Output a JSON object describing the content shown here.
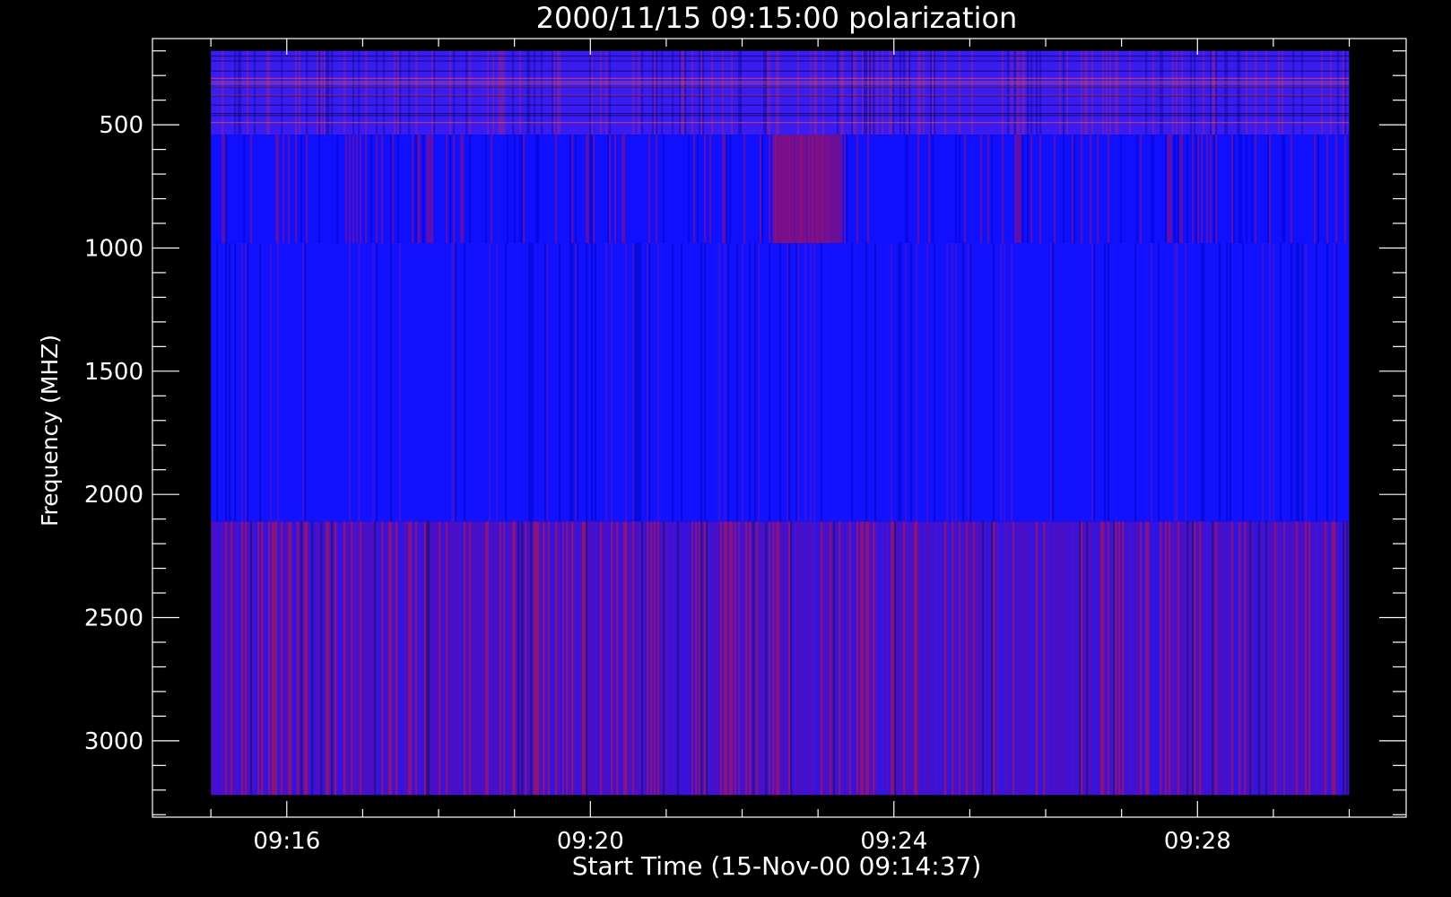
{
  "chart_data": {
    "type": "heatmap",
    "title": "2000/11/15 09:15:00 polarization",
    "xlabel": "Start Time (15-Nov-00 09:14:37)",
    "ylabel": "Frequency (MHZ)",
    "x_tick_labels": [
      "09:16",
      "09:20",
      "09:24",
      "09:28"
    ],
    "x_ticks_minutes": [
      16,
      20,
      24,
      28
    ],
    "x_range_minutes": [
      14.23,
      30.75
    ],
    "y_tick_labels": [
      "500",
      "1000",
      "1500",
      "2000",
      "2500",
      "3000"
    ],
    "y_ticks": [
      500,
      1000,
      1500,
      2000,
      2500,
      3000
    ],
    "y_range": [
      3310,
      150
    ],
    "y_reversed": true,
    "data_time_range_minutes": [
      15.0,
      30.0
    ],
    "data_freq_range_mhz": [
      200,
      3220
    ],
    "bands_mhz": [
      {
        "from": 200,
        "to": 540,
        "character": "noisy blue with red speckle and horizontal channel lines"
      },
      {
        "from": 540,
        "to": 980,
        "character": "bright blue with red vertical streaks, reddish near 09:22-09:23"
      },
      {
        "from": 980,
        "to": 2110,
        "character": "bright blue with faint vertical streaks"
      },
      {
        "from": 2110,
        "to": 3220,
        "character": "purple with red and dark vertical streaks"
      }
    ],
    "colors": {
      "background": "#000000",
      "axes": "#ffffff",
      "low": "#0000ff",
      "high": "#ff0000"
    }
  }
}
